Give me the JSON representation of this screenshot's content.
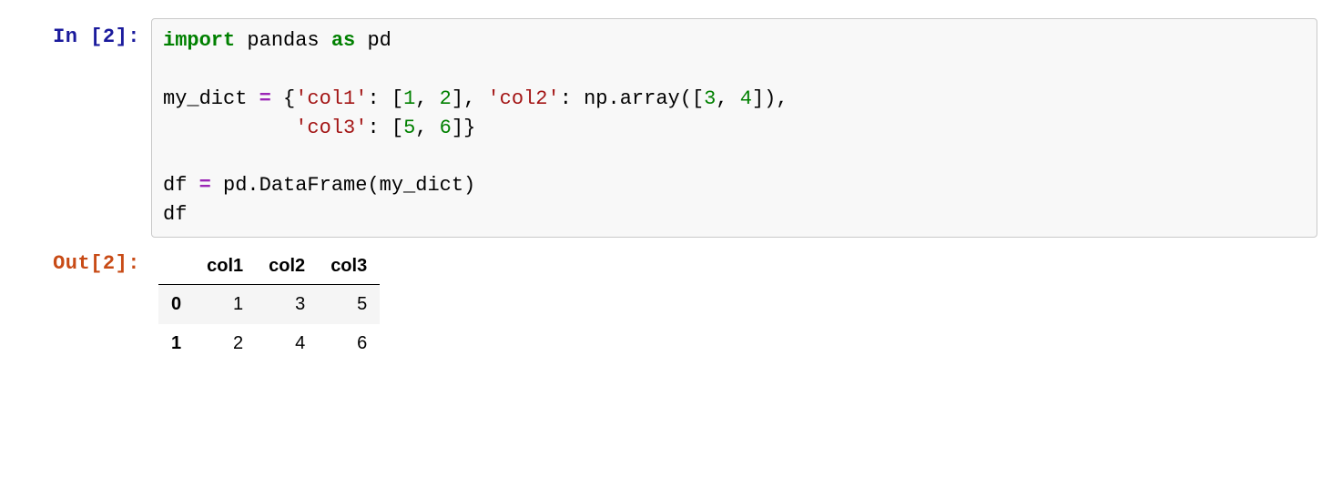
{
  "input": {
    "prompt": "In [2]:",
    "code": {
      "l1_import": "import",
      "l1_sp1": " pandas ",
      "l1_as": "as",
      "l1_sp2": " pd",
      "l3_pre": "my_dict ",
      "l3_eq": "=",
      "l3_sp": " {",
      "l3_s1": "'col1'",
      "l3_c1": ": [",
      "l3_n1": "1",
      "l3_cm1": ", ",
      "l3_n2": "2",
      "l3_cb1": "], ",
      "l3_s2": "'col2'",
      "l3_c2": ": np.array([",
      "l3_n3": "3",
      "l3_cm2": ", ",
      "l3_n4": "4",
      "l3_cb2": "]),",
      "l4_pad": "           ",
      "l4_s3": "'col3'",
      "l4_c3": ": [",
      "l4_n5": "5",
      "l4_cm3": ", ",
      "l4_n6": "6",
      "l4_cb3": "]}",
      "l6_pre": "df ",
      "l6_eq": "=",
      "l6_rest": " pd.DataFrame(my_dict)",
      "l7": "df"
    }
  },
  "output": {
    "prompt": "Out[2]:",
    "columns": [
      "col1",
      "col2",
      "col3"
    ],
    "index": [
      "0",
      "1"
    ],
    "rows": [
      [
        "1",
        "3",
        "5"
      ],
      [
        "2",
        "4",
        "6"
      ]
    ]
  }
}
